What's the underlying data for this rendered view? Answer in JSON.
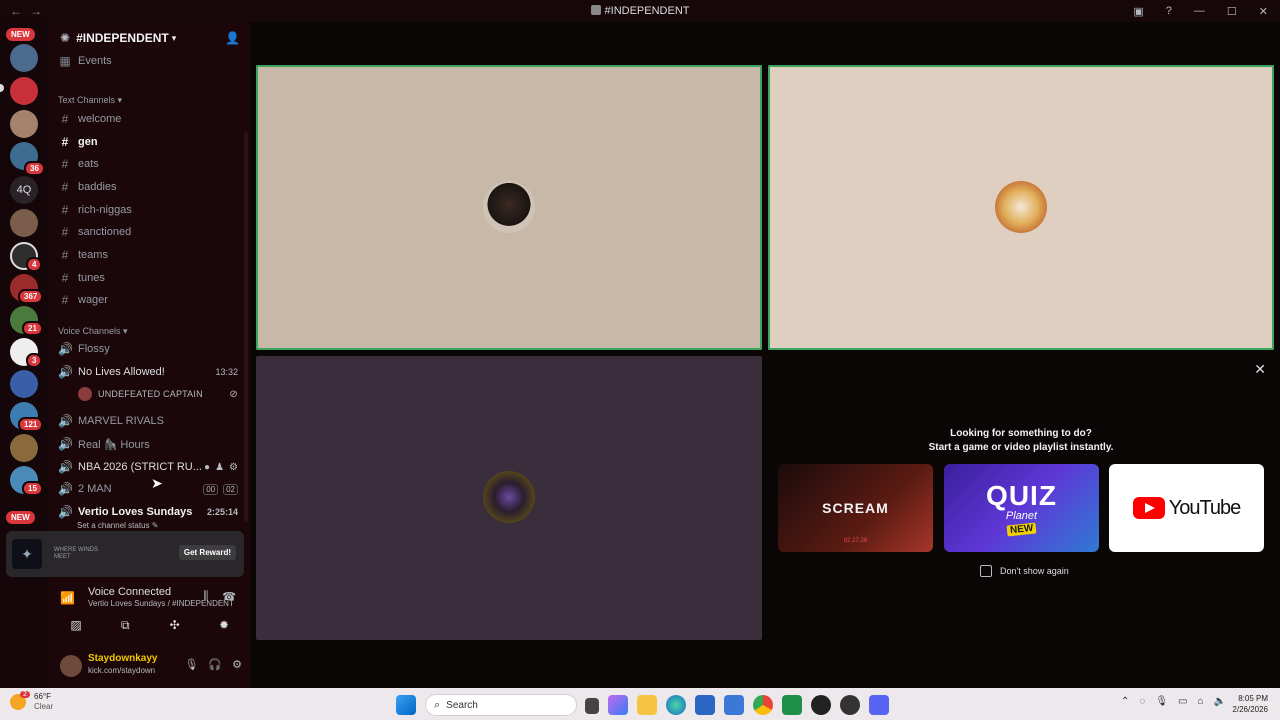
{
  "window": {
    "title": "#INDEPENDENT"
  },
  "rail": {
    "new_badge_top": "NEW",
    "new_badge_bottom": "NEW",
    "text_server": "4Q",
    "badges": [
      "36",
      "4",
      "367",
      "21",
      "3",
      "121",
      "15"
    ]
  },
  "server": {
    "name": "#INDEPENDENT",
    "events_label": "Events"
  },
  "text_channels": {
    "header": "Text Channels",
    "items": [
      "welcome",
      "gen",
      "eats",
      "baddies",
      "rich-niggas",
      "sanctioned",
      "teams",
      "tunes",
      "wager"
    ]
  },
  "voice_channels": {
    "header": "Voice Channels",
    "items": [
      {
        "name": "Flossy"
      },
      {
        "name": "No Lives Allowed!",
        "time": "13:32"
      },
      {
        "name": "MARVEL RIVALS"
      },
      {
        "name": "Real 🦍 Hours"
      },
      {
        "name": "NBA 2026 (STRICT RU..."
      },
      {
        "name": "2 MAN",
        "tag1": "00",
        "tag2": "02"
      },
      {
        "name": "Vertio Loves Sundays",
        "time": "2:25:14",
        "status": "Set a channel status"
      }
    ],
    "member": "UNDEFEATED CAPTAIN"
  },
  "promo": {
    "brand": "WHERE WINDS MEET",
    "button": "Get Reward!"
  },
  "voice_panel": {
    "title": "Voice Connected",
    "subtitle": "Vertio Loves Sundays / #INDEPENDENT"
  },
  "user": {
    "name": "Staydownkayy",
    "status": "kick.com/staydown"
  },
  "activity": {
    "heading": "Looking for something to do?",
    "subheading": "Start a game or video playlist instantly.",
    "cards": {
      "scream": "SCREAM",
      "scream_date": "02.27.26",
      "quiz_title": "QUIZ",
      "quiz_sub": "Planet",
      "quiz_badge": "NEW",
      "youtube": "YouTube"
    },
    "dont_show": "Don't show again"
  },
  "taskbar": {
    "temp": "66°F",
    "condition": "Clear",
    "weather_badge": "2",
    "search_placeholder": "Search",
    "time": "8:05 PM",
    "date": "2/26/2026"
  },
  "colors": {
    "speaking_outline": "#3ba55d",
    "badge_red": "#da373c",
    "username": "#f0c800"
  }
}
